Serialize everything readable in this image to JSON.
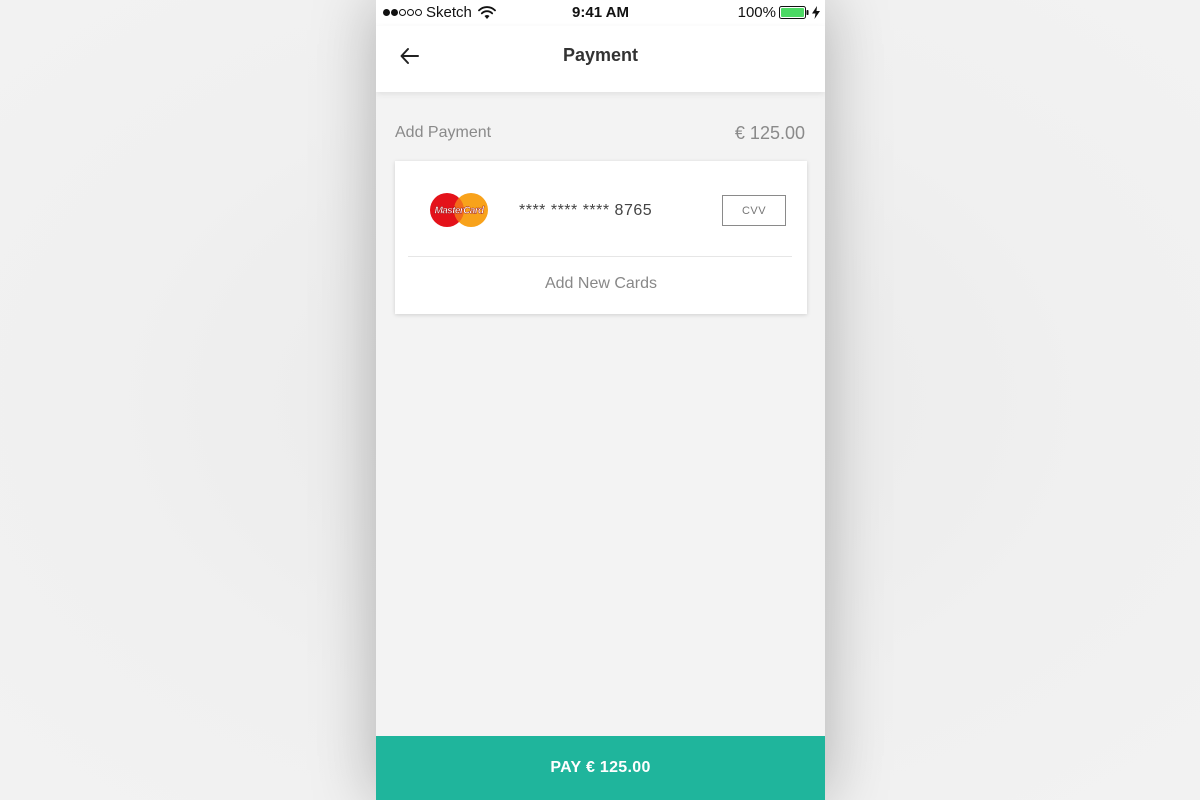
{
  "status_bar": {
    "carrier": "Sketch",
    "time": "9:41 AM",
    "battery": "100%",
    "battery_color": "#4cd964"
  },
  "nav": {
    "title": "Payment",
    "back_icon": "arrow-left-icon"
  },
  "section": {
    "label": "Add Payment",
    "amount": "€ 125.00"
  },
  "card": {
    "brand": "MasterCard",
    "number": "**** **** **** 8765",
    "cvv_placeholder": "CVV",
    "add_new_label": "Add New Cards"
  },
  "pay_button": {
    "label": "PAY € 125.00",
    "color": "#1fb59c"
  }
}
